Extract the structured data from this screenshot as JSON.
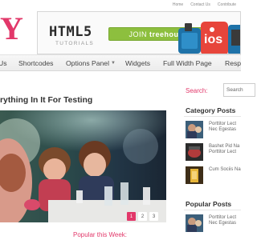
{
  "top_links": [
    "Home",
    "Contact Us",
    "Contribute"
  ],
  "logo_fragment": "Y",
  "banner": {
    "logo_text": "HTML5",
    "logo_subtext": "TUTORIALS",
    "join_label": "JOIN",
    "join_brand": "treehouse",
    "accent": "#8dbf3e"
  },
  "nav": {
    "items": [
      "Us",
      "Shortcodes",
      "Options Panel",
      "Widgets",
      "Full Width Page",
      "Resp"
    ],
    "dropdown_icon": "triangle-down"
  },
  "post": {
    "title": "rything In It For Testing",
    "slider_pages": [
      "1",
      "2",
      "3"
    ],
    "active_page": "1"
  },
  "popular_week": "Popular this Week:",
  "sidebar": {
    "search_label": "Search:",
    "search_placeholder": "Search",
    "category_title": "Category Posts",
    "category_items": [
      {
        "line1": "Porttitor Lect",
        "line2": "Nec Egestas"
      },
      {
        "line1": "Bashet Pid Na",
        "line2": "Porttitor Lect"
      },
      {
        "line1": "Cum Sociis Na",
        "line2": ""
      }
    ],
    "popular_title": "Popular Posts",
    "popular_items": [
      {
        "line1": "Porttitor Lect",
        "line2": "Nec Egestas"
      }
    ]
  },
  "colors": {
    "brand": "#e2386a",
    "nav_bg": "#f0f0f0",
    "text": "#333333"
  }
}
